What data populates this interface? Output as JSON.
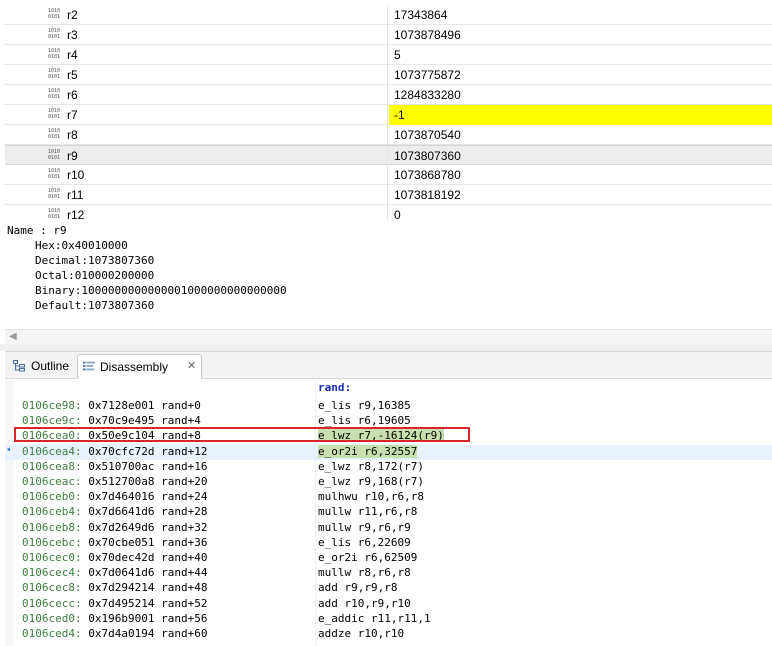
{
  "registers": [
    {
      "name": "r2",
      "value": "17343864",
      "changed": false,
      "selected": false
    },
    {
      "name": "r3",
      "value": "1073878496",
      "changed": false,
      "selected": false
    },
    {
      "name": "r4",
      "value": "5",
      "changed": false,
      "selected": false
    },
    {
      "name": "r5",
      "value": "1073775872",
      "changed": false,
      "selected": false
    },
    {
      "name": "r6",
      "value": "1284833280",
      "changed": false,
      "selected": false
    },
    {
      "name": "r7",
      "value": "-1",
      "changed": true,
      "selected": false
    },
    {
      "name": "r8",
      "value": "1073870540",
      "changed": false,
      "selected": false
    },
    {
      "name": "r9",
      "value": "1073807360",
      "changed": false,
      "selected": true
    },
    {
      "name": "r10",
      "value": "1073868780",
      "changed": false,
      "selected": false
    },
    {
      "name": "r11",
      "value": "1073818192",
      "changed": false,
      "selected": false
    },
    {
      "name": "r12",
      "value": "0",
      "changed": false,
      "selected": false
    }
  ],
  "details": {
    "name_line": "Name : r9",
    "hex": "Hex:0x40010000",
    "decimal": "Decimal:1073807360",
    "octal": "Octal:010000200000",
    "binary": "Binary:1000000000000001000000000000000",
    "default": "Default:1073807360"
  },
  "tabs": {
    "outline": "Outline",
    "disassembly": "Disassembly",
    "close": "✕"
  },
  "disassembly": {
    "function_label": "rand:",
    "lines": [
      {
        "addr": "0106ce98:",
        "rest": " 0x7128e001 rand+0",
        "instr": "e_lis r9,16385"
      },
      {
        "addr": "0106ce9c:",
        "rest": " 0x70c9e495 rand+4",
        "instr": "e_lis r6,19605"
      },
      {
        "addr": "0106cea0:",
        "rest": " 0x50e9c104 rand+8",
        "instr": "e_lwz r7,-16124(r9)"
      },
      {
        "addr": "0106cea4:",
        "rest": " 0x70cfc72d rand+12",
        "instr": "e_or2i r6,32557"
      },
      {
        "addr": "0106cea8:",
        "rest": " 0x510700ac rand+16",
        "instr": "e_lwz r8,172(r7)"
      },
      {
        "addr": "0106ceac:",
        "rest": " 0x512700a8 rand+20",
        "instr": "e_lwz r9,168(r7)"
      },
      {
        "addr": "0106ceb0:",
        "rest": " 0x7d464016 rand+24",
        "instr": "mulhwu r10,r6,r8"
      },
      {
        "addr": "0106ceb4:",
        "rest": " 0x7d6641d6 rand+28",
        "instr": "mullw r11,r6,r8"
      },
      {
        "addr": "0106ceb8:",
        "rest": " 0x7d2649d6 rand+32",
        "instr": "mullw r9,r6,r9"
      },
      {
        "addr": "0106cebc:",
        "rest": " 0x70cbe051 rand+36",
        "instr": "e_lis r6,22609"
      },
      {
        "addr": "0106cec0:",
        "rest": " 0x70dec42d rand+40",
        "instr": "e_or2i r6,62509"
      },
      {
        "addr": "0106cec4:",
        "rest": " 0x7d0641d6 rand+44",
        "instr": "mullw r8,r6,r8"
      },
      {
        "addr": "0106cec8:",
        "rest": " 0x7d294214 rand+48",
        "instr": "add r9,r9,r8"
      },
      {
        "addr": "0106cecc:",
        "rest": " 0x7d495214 rand+52",
        "instr": "add r10,r9,r10"
      },
      {
        "addr": "0106ced0:",
        "rest": " 0x196b9001 rand+56",
        "instr": "e_addic r11,r11,1"
      },
      {
        "addr": "0106ced4:",
        "rest": " 0x7d4a0194 rand+60",
        "instr": "addze r10,r10"
      }
    ]
  },
  "icons": {
    "register_icon": "binary-register-icon",
    "outline_icon": "outline-icon",
    "disassembly_icon": "disassembly-icon",
    "current_instruction": "instruction-pointer-arrow-icon"
  },
  "colors": {
    "changed_value": "#ffff00",
    "address_green": "#3f7f3f",
    "highlight_box": "#d9262b",
    "current_line": "#e8f2fe"
  }
}
